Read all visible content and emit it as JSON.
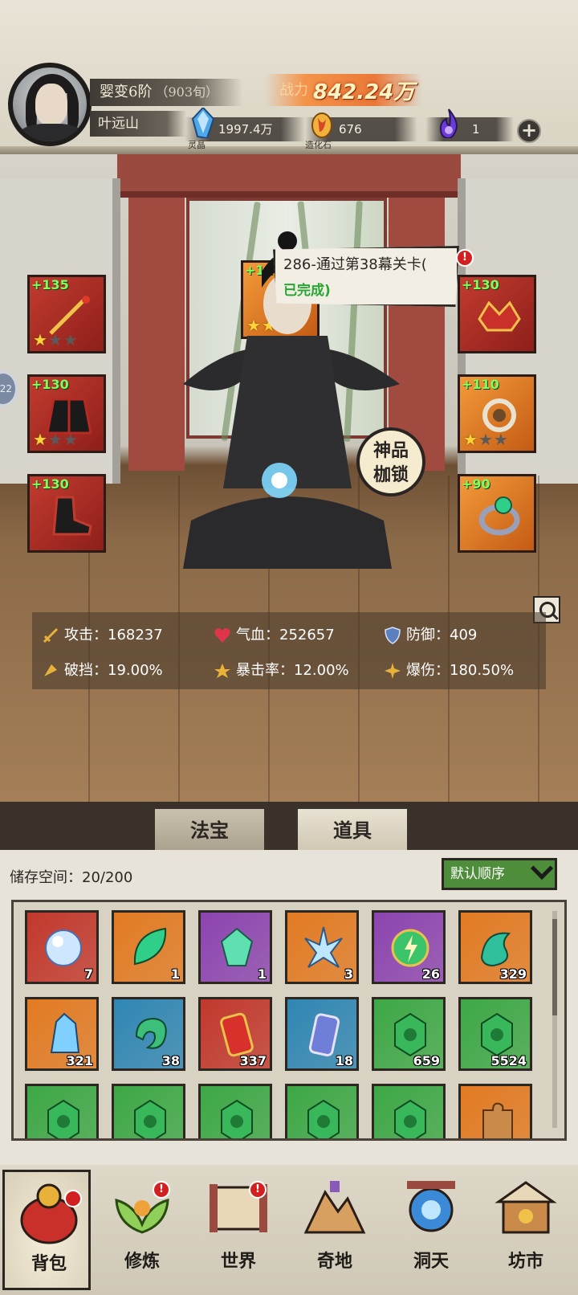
{
  "player": {
    "realm": "婴变6阶",
    "realm_detail": "（903旬）",
    "name": "叶远山",
    "power_label": "战力",
    "power_value": "842.24万"
  },
  "resources": [
    {
      "icon": "spirit-crystal-icon",
      "caption": "灵晶",
      "value": "1997.4万"
    },
    {
      "icon": "creation-stone-icon",
      "caption": "造化石",
      "value": "676"
    },
    {
      "icon": "purple-flame-icon",
      "caption": "",
      "value": "1"
    }
  ],
  "equipment": [
    {
      "slot": "weapon",
      "bonus": "+135",
      "stars": 1,
      "color": "red"
    },
    {
      "slot": "armor",
      "bonus": "+130",
      "stars": 1,
      "color": "red"
    },
    {
      "slot": "boots",
      "bonus": "+130",
      "stars": 0,
      "color": "red"
    },
    {
      "slot": "top",
      "bonus": "+12",
      "stars": 3,
      "color": "orange"
    },
    {
      "slot": "crown",
      "bonus": "+130",
      "stars": 0,
      "color": "red"
    },
    {
      "slot": "necklace",
      "bonus": "+110",
      "stars": 1,
      "color": "orange"
    },
    {
      "slot": "ring",
      "bonus": "+90",
      "stars": 0,
      "color": "orange"
    }
  ],
  "quest": {
    "title": "286-通过第38幕关卡(",
    "status": "已完成)"
  },
  "badge": {
    "text": "神品枷锁"
  },
  "stats": {
    "attack_label": "攻击：",
    "attack": "168237",
    "hp_label": "气血：",
    "hp": "252657",
    "defense_label": "防御：",
    "defense": "409",
    "pierce_label": "破挡：",
    "pierce": "19.00%",
    "crit_label": "暴击率：",
    "crit": "12.00%",
    "critdmg_label": "爆伤：",
    "critdmg": "180.50%"
  },
  "tabs": [
    {
      "label": "法宝"
    },
    {
      "label": "道具"
    }
  ],
  "inventory": {
    "storage_label": "储存空间：",
    "storage_value": "20/200",
    "sort_label": "默认顺序",
    "items": [
      {
        "icon": "pearl-icon",
        "count": "7",
        "color": "#c2382c"
      },
      {
        "icon": "jade-leaf-icon",
        "count": "1",
        "color": "#e27a22"
      },
      {
        "icon": "green-crystal-icon",
        "count": "1",
        "color": "#8c44b0"
      },
      {
        "icon": "ice-crystal-icon",
        "count": "3",
        "color": "#e27a22"
      },
      {
        "icon": "thunder-orb-icon",
        "count": "26",
        "color": "#8c44b0"
      },
      {
        "icon": "jade-swirl-icon",
        "count": "329",
        "color": "#e27a22"
      },
      {
        "icon": "blue-crystal-icon",
        "count": "321",
        "color": "#e27a22"
      },
      {
        "icon": "jade-curl-icon",
        "count": "38",
        "color": "#2f86b4"
      },
      {
        "icon": "red-talisman-icon",
        "count": "337",
        "color": "#c2382c"
      },
      {
        "icon": "blue-talisman-icon",
        "count": "18",
        "color": "#2f86b4"
      },
      {
        "icon": "green-rune-icon",
        "count": "659",
        "color": "#3da846"
      },
      {
        "icon": "green-rune-icon",
        "count": "5524",
        "color": "#3da846"
      },
      {
        "icon": "green-rune-icon",
        "count": "",
        "color": "#3da846"
      },
      {
        "icon": "green-rune-icon",
        "count": "",
        "color": "#3da846"
      },
      {
        "icon": "green-rune-icon",
        "count": "",
        "color": "#3da846"
      },
      {
        "icon": "green-rune-icon",
        "count": "",
        "color": "#3da846"
      },
      {
        "icon": "green-rune-icon",
        "count": "",
        "color": "#3da846"
      },
      {
        "icon": "puzzle-piece-icon",
        "count": "",
        "color": "#e27a22"
      }
    ]
  },
  "nav": [
    {
      "label": "背包",
      "icon": "bag-icon",
      "active": true
    },
    {
      "label": "修炼",
      "icon": "lotus-icon",
      "active": false
    },
    {
      "label": "世界",
      "icon": "scroll-map-icon",
      "active": false
    },
    {
      "label": "奇地",
      "icon": "mountain-icon",
      "active": false
    },
    {
      "label": "洞天",
      "icon": "portal-icon",
      "active": false
    },
    {
      "label": "坊市",
      "icon": "market-icon",
      "active": false
    }
  ]
}
